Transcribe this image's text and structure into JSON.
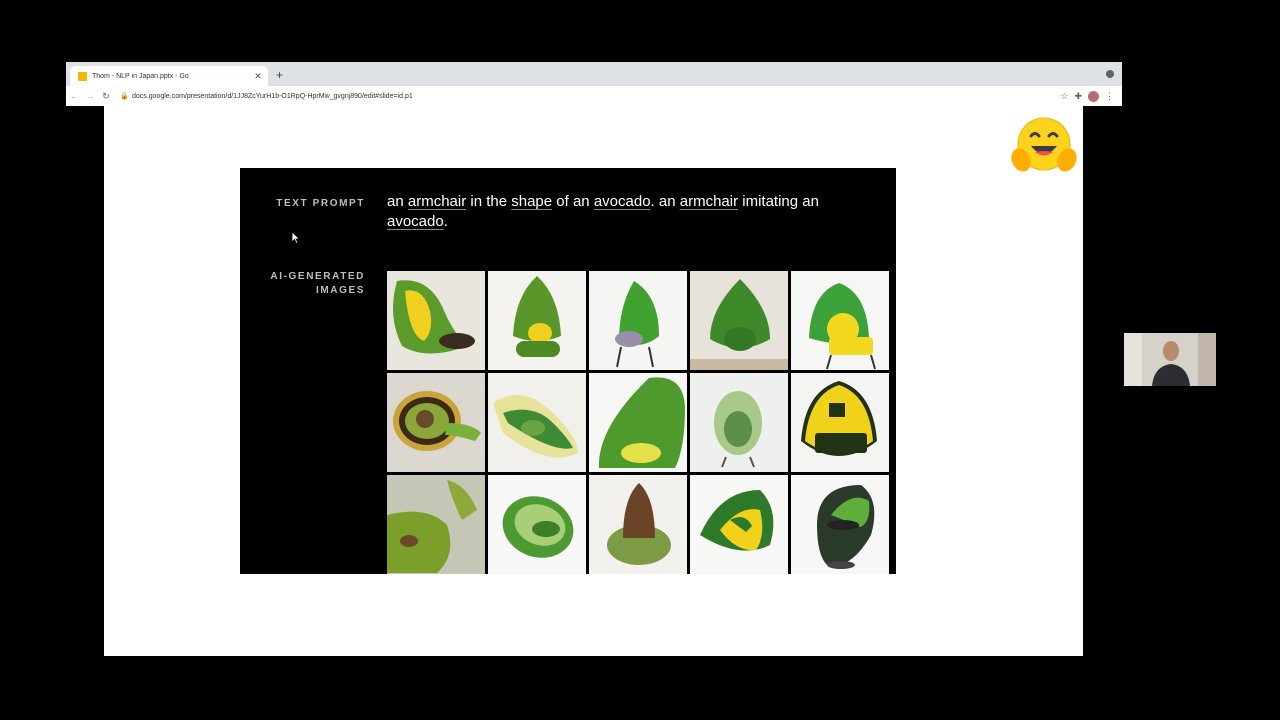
{
  "browser": {
    "tab_title": "Thom - NLP in Japan.pptx - Go",
    "new_tab_icon": "+",
    "url": "docs.google.com/presentation/d/1JJ8ZcYurH1b-O1RpQ-HprMw_gvgnj890/edit#slide=id.p1"
  },
  "slide": {
    "label_prompt": "TEXT PROMPT",
    "label_ai_line1": "AI-GENERATED",
    "label_ai_line2": "IMAGES",
    "prompt": {
      "t1": "an ",
      "u1": "armchair",
      "t2": " in the ",
      "u2": "shape",
      "t3": " of an ",
      "u3": "avocado",
      "t4": ". an ",
      "u4": "armchair",
      "t5": " imitating an ",
      "u5": "avocado",
      "t6": "."
    },
    "images": [
      "avocado-chair-1",
      "avocado-chair-2",
      "avocado-chair-3",
      "avocado-chair-4",
      "avocado-chair-5",
      "avocado-chair-6",
      "avocado-chair-7",
      "avocado-chair-8",
      "avocado-chair-9",
      "avocado-chair-10",
      "avocado-chair-11",
      "avocado-chair-12",
      "avocado-chair-13",
      "avocado-chair-14",
      "avocado-chair-15"
    ]
  },
  "colors": {
    "avocado_green": "#5fa22c",
    "avocado_yellow": "#f2d52a",
    "pit_brown": "#6b4a2b"
  }
}
